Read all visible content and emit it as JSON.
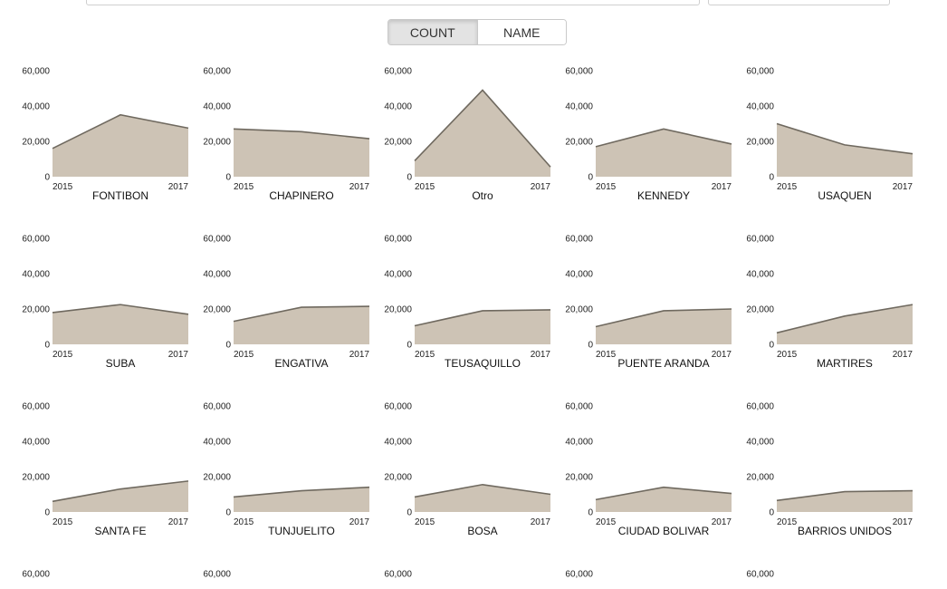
{
  "controls": {
    "sort_options": [
      {
        "label": "COUNT",
        "active": true
      },
      {
        "label": "NAME",
        "active": false
      }
    ]
  },
  "colors": {
    "area_fill": "#cdc3b5",
    "area_stroke": "#6f695f"
  },
  "chart_data": [
    {
      "type": "area",
      "title": "FONTIBON",
      "x": [
        2015,
        2016,
        2017
      ],
      "values": [
        16000,
        35000,
        27500
      ],
      "ylim": [
        0,
        60000
      ],
      "yticks": [
        "0",
        "20,000",
        "40,000",
        "60,000"
      ],
      "xticks": [
        "2015",
        "2017"
      ]
    },
    {
      "type": "area",
      "title": "CHAPINERO",
      "x": [
        2015,
        2016,
        2017
      ],
      "values": [
        27000,
        25500,
        21500
      ],
      "ylim": [
        0,
        60000
      ],
      "yticks": [
        "0",
        "20,000",
        "40,000",
        "60,000"
      ],
      "xticks": [
        "2015",
        "2017"
      ]
    },
    {
      "type": "area",
      "title": "Otro",
      "x": [
        2015,
        2016,
        2017
      ],
      "values": [
        9000,
        49000,
        5500
      ],
      "ylim": [
        0,
        60000
      ],
      "yticks": [
        "0",
        "20,000",
        "40,000",
        "60,000"
      ],
      "xticks": [
        "2015",
        "2017"
      ]
    },
    {
      "type": "area",
      "title": "KENNEDY",
      "x": [
        2015,
        2016,
        2017
      ],
      "values": [
        17000,
        27000,
        18500
      ],
      "ylim": [
        0,
        60000
      ],
      "yticks": [
        "0",
        "20,000",
        "40,000",
        "60,000"
      ],
      "xticks": [
        "2015",
        "2017"
      ]
    },
    {
      "type": "area",
      "title": "USAQUEN",
      "x": [
        2015,
        2016,
        2017
      ],
      "values": [
        30000,
        18000,
        13000
      ],
      "ylim": [
        0,
        60000
      ],
      "yticks": [
        "0",
        "20,000",
        "40,000",
        "60,000"
      ],
      "xticks": [
        "2015",
        "2017"
      ]
    },
    {
      "type": "area",
      "title": "SUBA",
      "x": [
        2015,
        2016,
        2017
      ],
      "values": [
        18000,
        22500,
        17000
      ],
      "ylim": [
        0,
        60000
      ],
      "yticks": [
        "0",
        "20,000",
        "40,000",
        "60,000"
      ],
      "xticks": [
        "2015",
        "2017"
      ]
    },
    {
      "type": "area",
      "title": "ENGATIVA",
      "x": [
        2015,
        2016,
        2017
      ],
      "values": [
        13000,
        21000,
        21500
      ],
      "ylim": [
        0,
        60000
      ],
      "yticks": [
        "0",
        "20,000",
        "40,000",
        "60,000"
      ],
      "xticks": [
        "2015",
        "2017"
      ]
    },
    {
      "type": "area",
      "title": "TEUSAQUILLO",
      "x": [
        2015,
        2016,
        2017
      ],
      "values": [
        10500,
        19000,
        19500
      ],
      "ylim": [
        0,
        60000
      ],
      "yticks": [
        "0",
        "20,000",
        "40,000",
        "60,000"
      ],
      "xticks": [
        "2015",
        "2017"
      ]
    },
    {
      "type": "area",
      "title": "PUENTE ARANDA",
      "x": [
        2015,
        2016,
        2017
      ],
      "values": [
        10000,
        19000,
        20000
      ],
      "ylim": [
        0,
        60000
      ],
      "yticks": [
        "0",
        "20,000",
        "40,000",
        "60,000"
      ],
      "xticks": [
        "2015",
        "2017"
      ]
    },
    {
      "type": "area",
      "title": "MARTIRES",
      "x": [
        2015,
        2016,
        2017
      ],
      "values": [
        6500,
        16000,
        22500
      ],
      "ylim": [
        0,
        60000
      ],
      "yticks": [
        "0",
        "20,000",
        "40,000",
        "60,000"
      ],
      "xticks": [
        "2015",
        "2017"
      ]
    },
    {
      "type": "area",
      "title": "SANTA FE",
      "x": [
        2015,
        2016,
        2017
      ],
      "values": [
        6000,
        13000,
        17500
      ],
      "ylim": [
        0,
        60000
      ],
      "yticks": [
        "0",
        "20,000",
        "40,000",
        "60,000"
      ],
      "xticks": [
        "2015",
        "2017"
      ]
    },
    {
      "type": "area",
      "title": "TUNJUELITO",
      "x": [
        2015,
        2016,
        2017
      ],
      "values": [
        8500,
        12000,
        14000
      ],
      "ylim": [
        0,
        60000
      ],
      "yticks": [
        "0",
        "20,000",
        "40,000",
        "60,000"
      ],
      "xticks": [
        "2015",
        "2017"
      ]
    },
    {
      "type": "area",
      "title": "BOSA",
      "x": [
        2015,
        2016,
        2017
      ],
      "values": [
        8500,
        15500,
        10000
      ],
      "ylim": [
        0,
        60000
      ],
      "yticks": [
        "0",
        "20,000",
        "40,000",
        "60,000"
      ],
      "xticks": [
        "2015",
        "2017"
      ]
    },
    {
      "type": "area",
      "title": "CIUDAD BOLIVAR",
      "x": [
        2015,
        2016,
        2017
      ],
      "values": [
        7000,
        14000,
        10500
      ],
      "ylim": [
        0,
        60000
      ],
      "yticks": [
        "0",
        "20,000",
        "40,000",
        "60,000"
      ],
      "xticks": [
        "2015",
        "2017"
      ]
    },
    {
      "type": "area",
      "title": "BARRIOS UNIDOS",
      "x": [
        2015,
        2016,
        2017
      ],
      "values": [
        6500,
        11500,
        12000
      ],
      "ylim": [
        0,
        60000
      ],
      "yticks": [
        "0",
        "20,000",
        "40,000",
        "60,000"
      ],
      "xticks": [
        "2015",
        "2017"
      ]
    },
    {
      "type": "area",
      "title": "",
      "x": [],
      "values": [],
      "ylim": [
        0,
        60000
      ],
      "yticks": [
        "60,000"
      ],
      "xticks": []
    },
    {
      "type": "area",
      "title": "",
      "x": [],
      "values": [],
      "ylim": [
        0,
        60000
      ],
      "yticks": [
        "60,000"
      ],
      "xticks": []
    },
    {
      "type": "area",
      "title": "",
      "x": [],
      "values": [],
      "ylim": [
        0,
        60000
      ],
      "yticks": [
        "60,000"
      ],
      "xticks": []
    },
    {
      "type": "area",
      "title": "",
      "x": [],
      "values": [],
      "ylim": [
        0,
        60000
      ],
      "yticks": [
        "60,000"
      ],
      "xticks": []
    },
    {
      "type": "area",
      "title": "",
      "x": [],
      "values": [],
      "ylim": [
        0,
        60000
      ],
      "yticks": [
        "60,000"
      ],
      "xticks": []
    }
  ]
}
